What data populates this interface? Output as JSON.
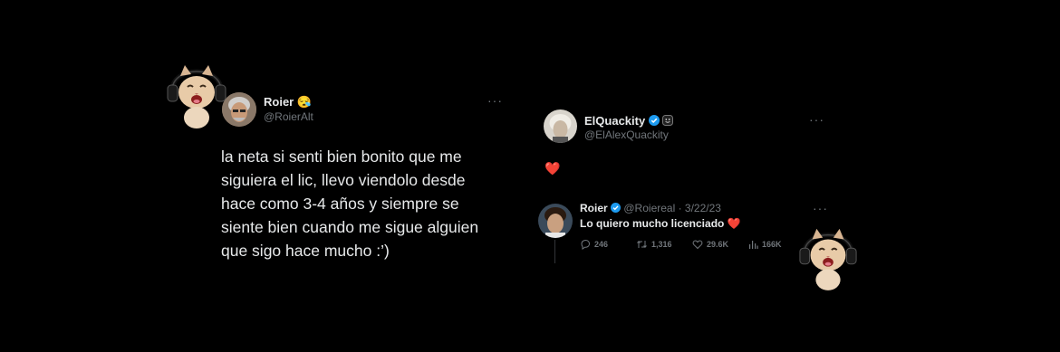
{
  "tweet_left": {
    "name": "Roier",
    "name_emoji": "😪",
    "handle": "@RoierAlt",
    "more": "···",
    "lines": [
      "la neta si senti bien bonito que me",
      "siguiera el lic, llevo viendolo desde",
      "hace como 3-4 años y siempre se",
      "siente bien cuando me sigue alguien",
      "que sigo hace mucho :’)"
    ]
  },
  "tweet_quote": {
    "name": "ElQuackity",
    "handle": "@ElAlexQuackity",
    "more": "···",
    "body_emoji": "❤️"
  },
  "tweet_reply": {
    "name": "Roier",
    "meta": "@Roiereal · 3/22/23",
    "more": "···",
    "text": "Lo quiero mucho licenciado ❤️",
    "replies": "246",
    "retweets": "1,316",
    "likes": "29.6K",
    "views": "166K"
  },
  "colors": {
    "background": "#000000",
    "verified_blue": "#1d9bf0",
    "heart_red": "#e0245e"
  }
}
